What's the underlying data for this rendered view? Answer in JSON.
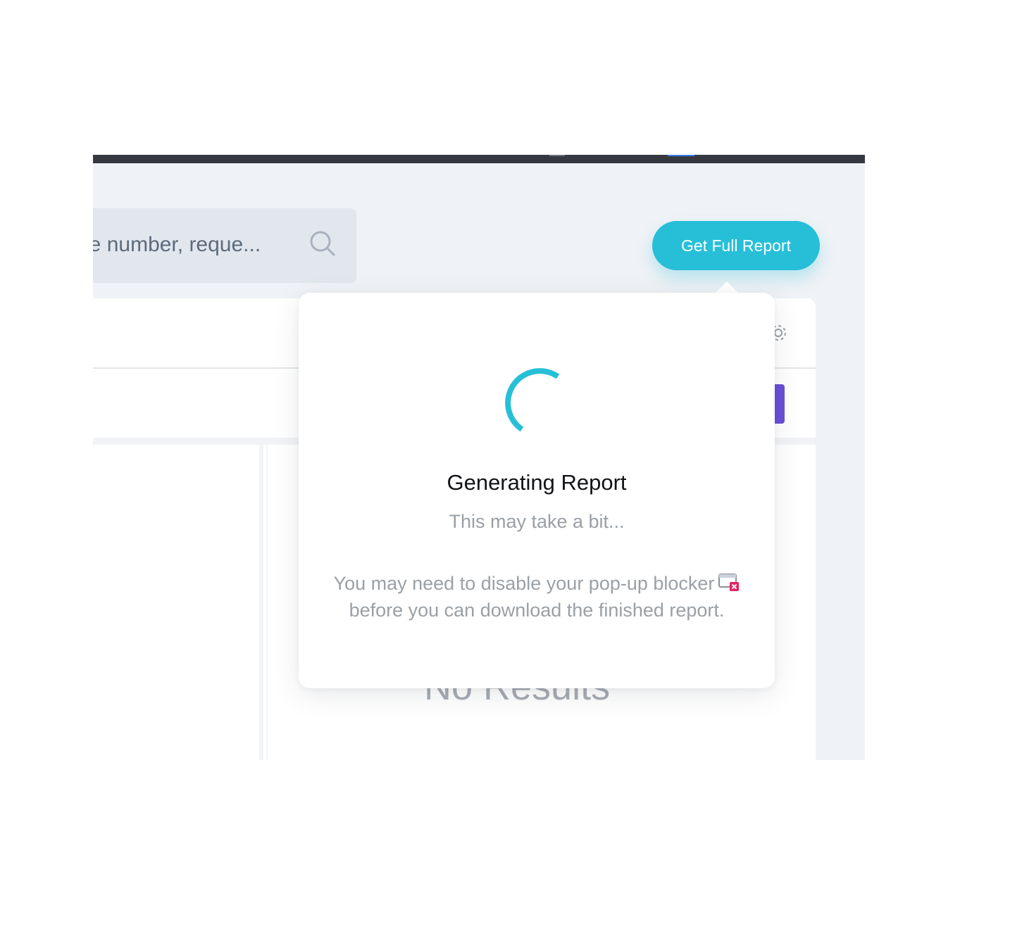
{
  "search": {
    "placeholder": "ne number, reque...",
    "icon": "search-icon"
  },
  "header": {
    "get_report_label": "Get Full Report"
  },
  "panel": {
    "settings_icon": "gear-icon",
    "empty_state": "No Results"
  },
  "popover": {
    "title": "Generating Report",
    "subtitle": "This may take a bit...",
    "note_line1": "You may need to disable your pop-up blocker",
    "note_line2": "before you can download the finished report.",
    "note_icon": "popup-blocker-icon"
  },
  "colors": {
    "accent": "#27bfd8",
    "purple": "#6a4fd6",
    "topbar": "#35393f",
    "background": "#eff2f6"
  }
}
